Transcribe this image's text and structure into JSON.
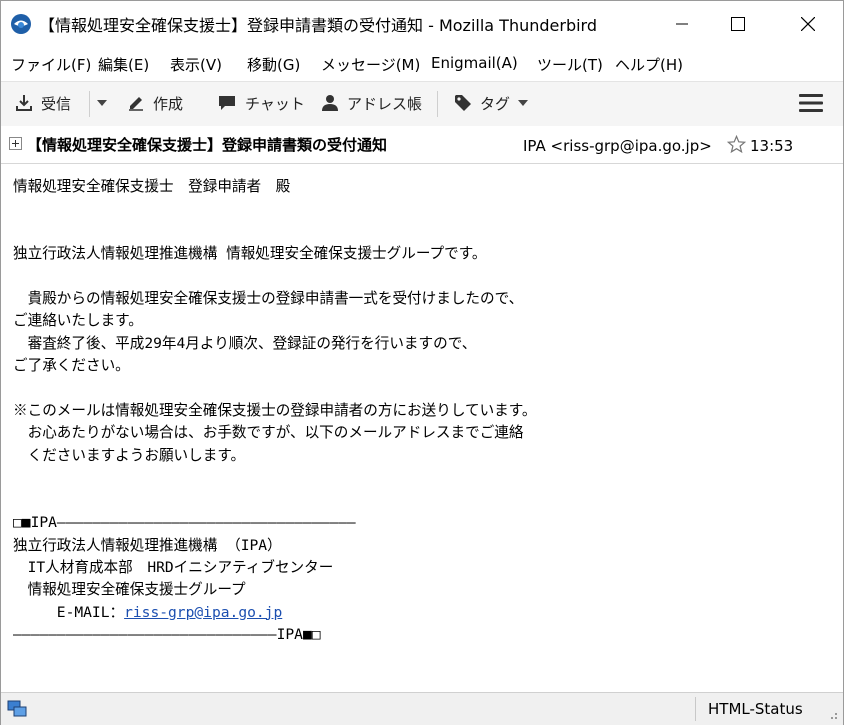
{
  "window": {
    "title": "【情報処理安全確保支援士】登録申請書類の受付通知 - Mozilla Thunderbird"
  },
  "menu": [
    "ファイル(F)",
    "編集(E)",
    "表示(V)",
    "移動(G)",
    "メッセージ(M)",
    "Enigmail(A)",
    "ツール(T)",
    "ヘルプ(H)"
  ],
  "toolbar": {
    "get_mail": "受信",
    "write": "作成",
    "chat": "チャット",
    "address_book": "アドレス帳",
    "tag": "タグ"
  },
  "header": {
    "subject": "【情報処理安全確保支援士】登録申請書類の受付通知",
    "from": "IPA <riss-grp@ipa.go.jp>",
    "time": "13:53"
  },
  "body": {
    "lines": [
      "情報処理安全確保支援士　登録申請者　殿",
      "",
      "",
      "独立行政法人情報処理推進機構 情報処理安全確保支援士グループです。",
      "",
      "　貴殿からの情報処理安全確保支援士の登録申請書一式を受付けましたので、",
      "ご連絡いたします。",
      "　審査終了後、平成29年4月より順次、登録証の発行を行いますので、",
      "ご了承ください。",
      "",
      "※このメールは情報処理安全確保支援士の登録申請者の方にお送りしています。",
      "　お心あたりがない場合は、お手数ですが、以下のメールアドレスまでご連絡",
      "　くださいますようお願いします。",
      "",
      "",
      "□■IPA――――――――――――――――――――――――――――――――――",
      "独立行政法人情報処理推進機構 （IPA）",
      "　IT人材育成本部　HRDイニシアティブセンター",
      "　情報処理安全確保支援士グループ"
    ],
    "email_label": "　　　E-MAIL：",
    "email_link": "riss-grp@ipa.go.jp",
    "footer_line": "――――――――――――――――――――――――――――――IPA■□"
  },
  "status": {
    "html_status": "HTML-Status"
  },
  "colors": {
    "link": "#1c4fb0",
    "toolbar_bg": "#f5f5f5",
    "statusbar_bg": "#f0f0f0"
  }
}
